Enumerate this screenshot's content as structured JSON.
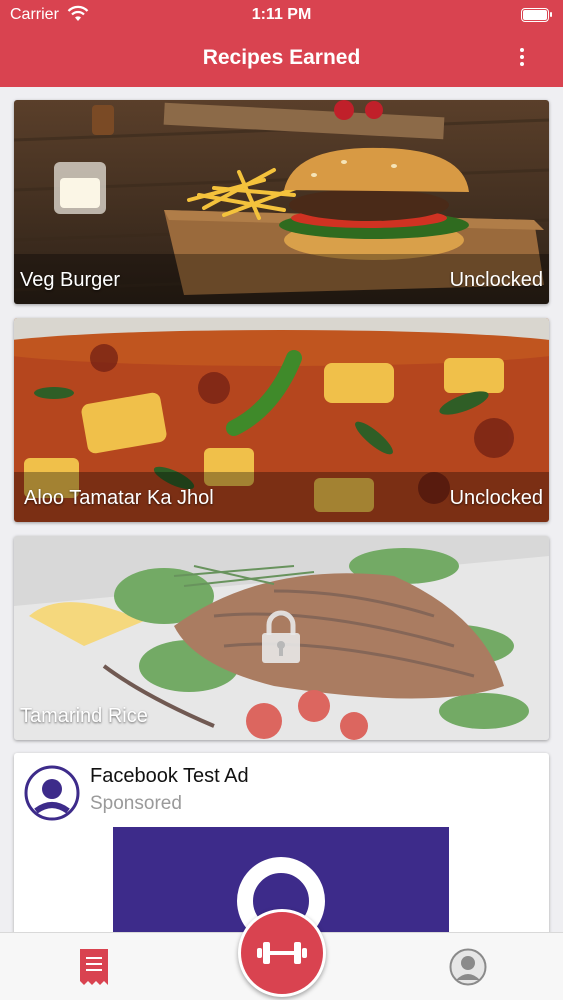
{
  "status_bar": {
    "carrier": "Carrier",
    "time": "1:11 PM"
  },
  "nav": {
    "title": "Recipes Earned",
    "menu_icon": "more-vertical-icon"
  },
  "recipes": [
    {
      "name": "Veg Burger",
      "status": "Unclocked"
    },
    {
      "name": "Aloo Tamatar Ka Jhol",
      "status": "Unclocked"
    },
    {
      "name": "Tamarind Rice",
      "status": "",
      "locked": true
    }
  ],
  "ad": {
    "title": "Facebook Test Ad",
    "sponsored": "Sponsored"
  },
  "tabbar": {
    "items": [
      {
        "icon": "receipt-icon",
        "active": true
      },
      {
        "icon": "dumbbell-icon"
      },
      {
        "icon": "profile-icon"
      }
    ]
  },
  "colors": {
    "accent": "#d94350",
    "ad_banner": "#3d2b8a"
  }
}
